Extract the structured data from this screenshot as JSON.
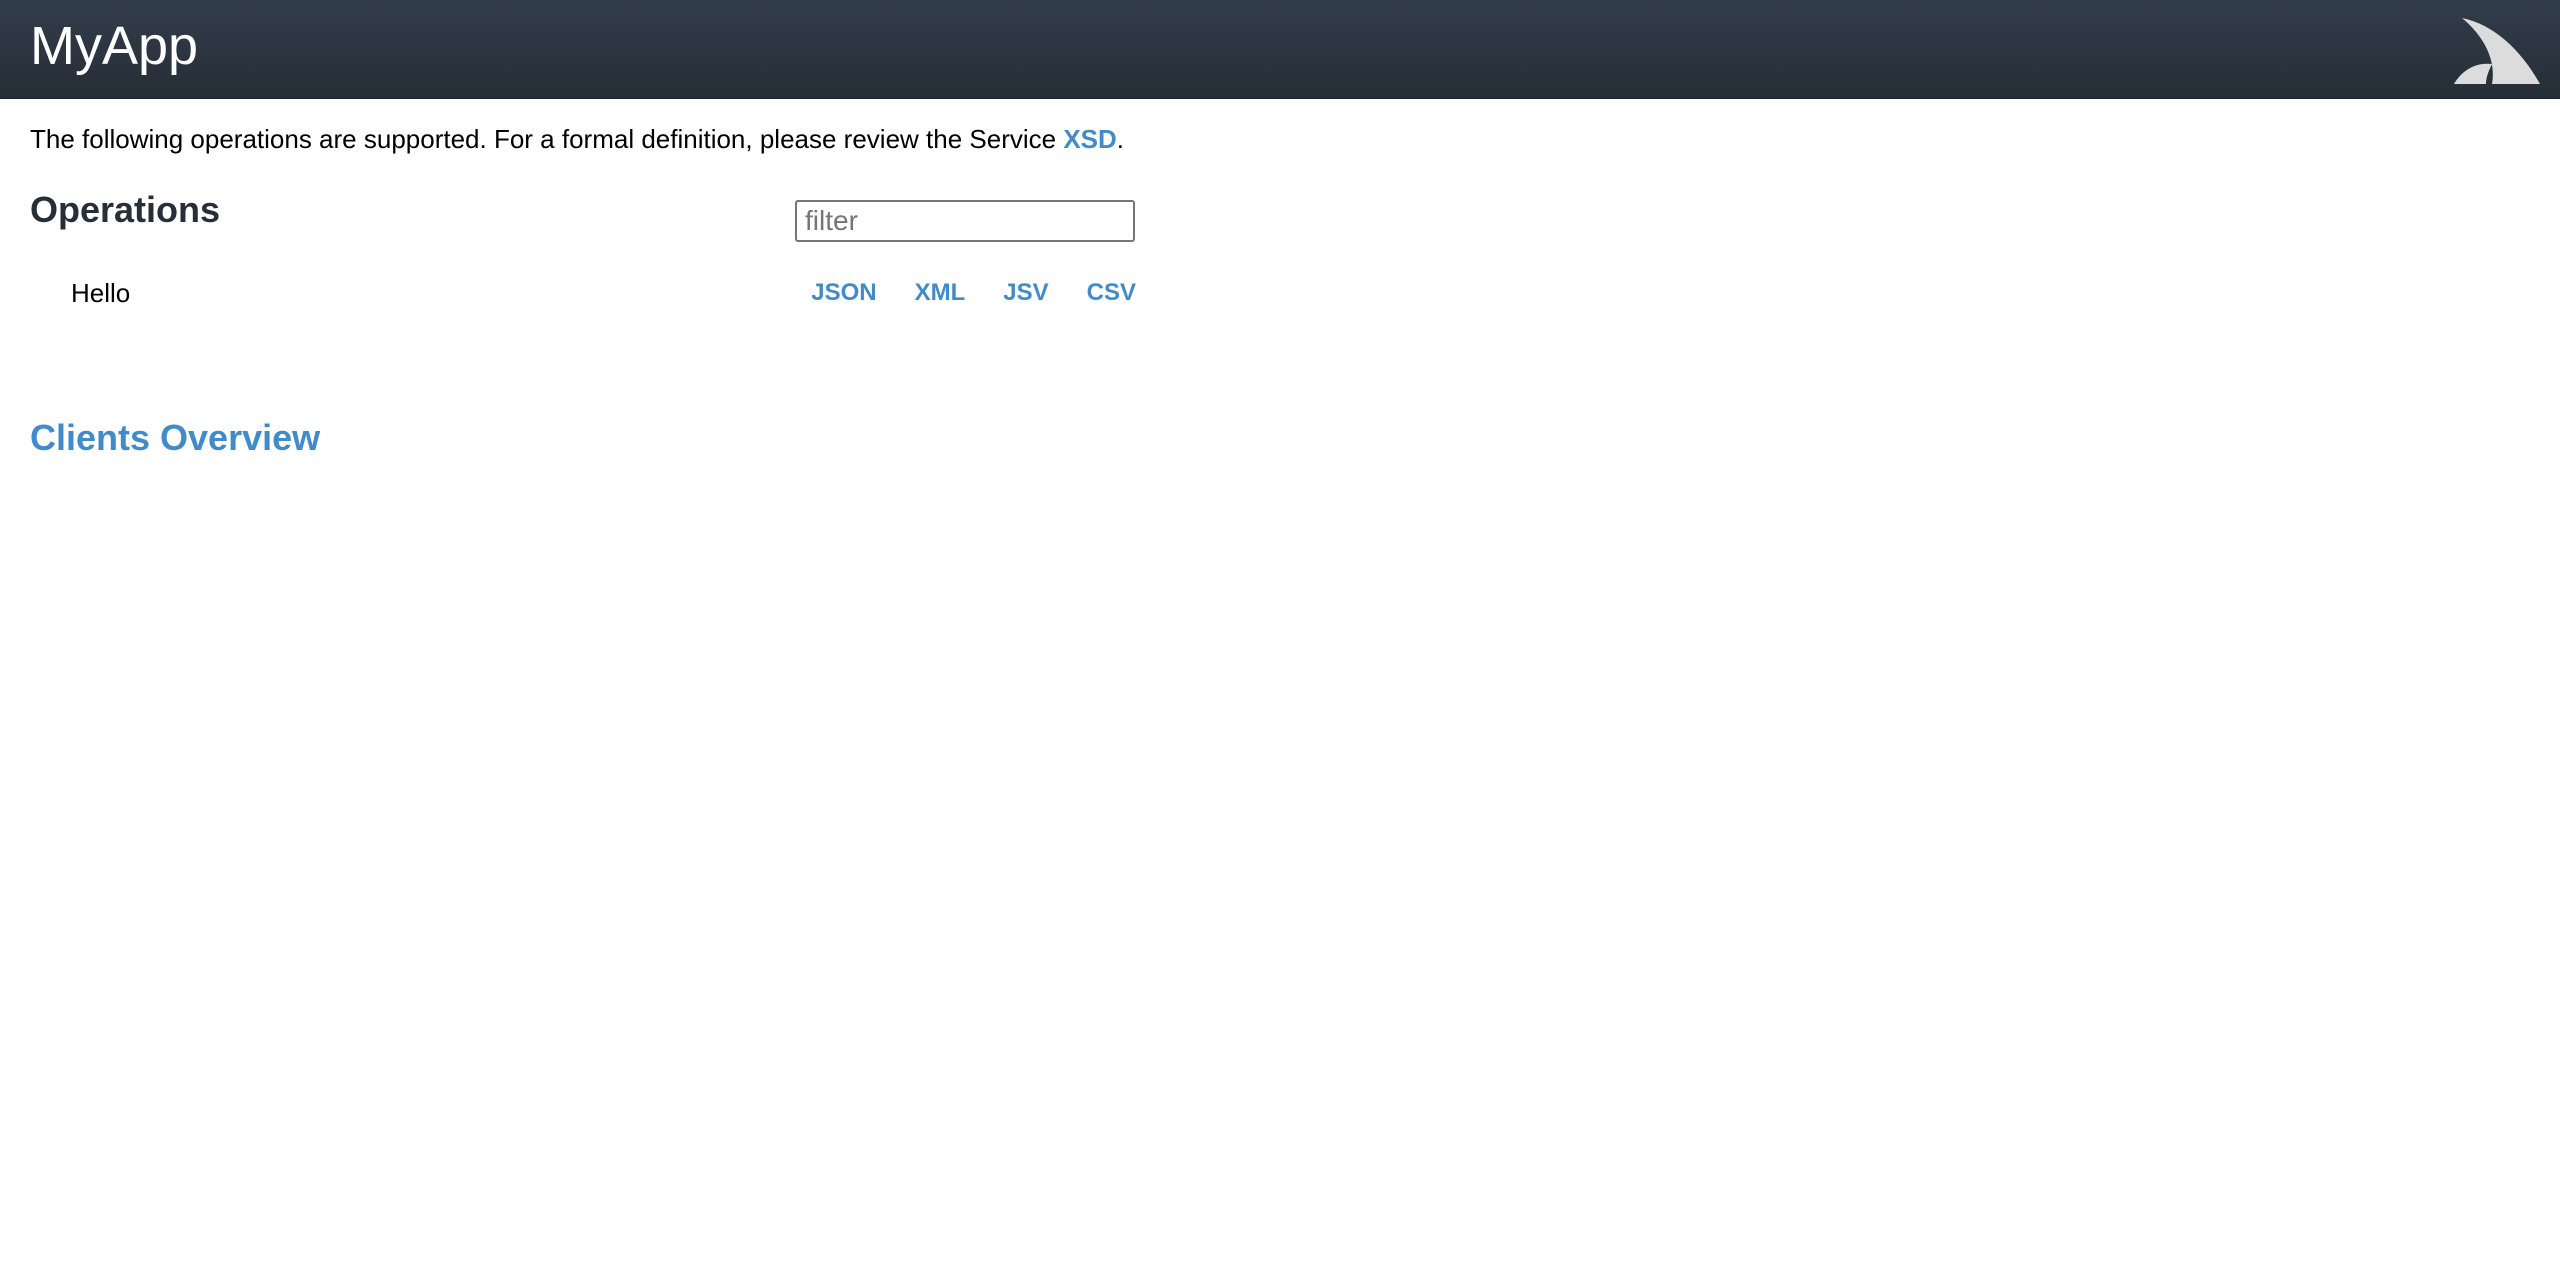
{
  "header": {
    "title": "MyApp",
    "logo_icon": "servicestack-logo-icon"
  },
  "intro": {
    "text_before": "The following operations are supported. For a formal definition, please review the Service ",
    "xsd_link": "XSD",
    "text_after": "."
  },
  "operations": {
    "heading": "Operations",
    "filter": {
      "placeholder": "filter",
      "value": ""
    },
    "items": [
      {
        "name": "Hello",
        "formats": [
          "JSON",
          "XML",
          "JSV",
          "CSV"
        ]
      }
    ]
  },
  "clients": {
    "heading": "Clients Overview"
  },
  "colors": {
    "header_bg": "#2c3540",
    "link": "#428bca",
    "heading": "#262e37"
  }
}
